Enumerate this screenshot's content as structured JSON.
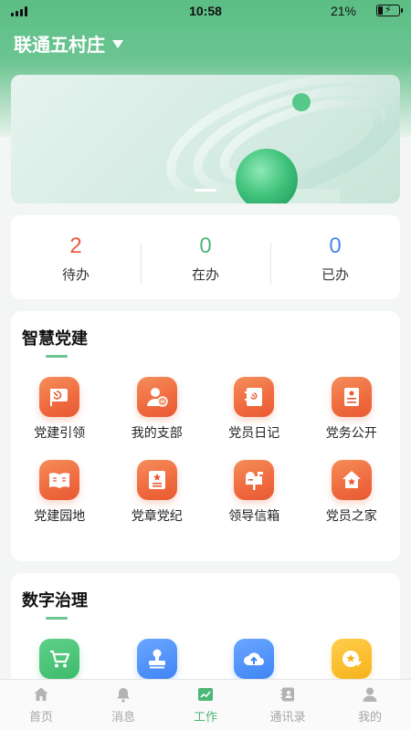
{
  "status_bar": {
    "time": "10:58",
    "battery": "21%",
    "battery_level": 0.21
  },
  "header": {
    "village": "联通五村庄"
  },
  "stats": [
    {
      "num": "2",
      "label": "待办",
      "color": "#e85a3c"
    },
    {
      "num": "0",
      "label": "在办",
      "color": "#4cb878"
    },
    {
      "num": "0",
      "label": "已办",
      "color": "#4a86e8"
    }
  ],
  "party_section": {
    "title": "智慧党建",
    "items": [
      {
        "label": "党建引领",
        "icon": "party-flag-icon"
      },
      {
        "label": "我的支部",
        "icon": "branch-member-icon"
      },
      {
        "label": "党员日记",
        "icon": "diary-book-icon"
      },
      {
        "label": "党务公开",
        "icon": "notice-document-icon"
      },
      {
        "label": "党建园地",
        "icon": "open-book-icon"
      },
      {
        "label": "党章党纪",
        "icon": "rules-book-icon"
      },
      {
        "label": "领导信箱",
        "icon": "mailbox-icon"
      },
      {
        "label": "党员之家",
        "icon": "home-star-icon"
      }
    ]
  },
  "digital_section": {
    "title": "数字治理",
    "items": [
      {
        "icon": "shopping-cart-icon",
        "color": "green"
      },
      {
        "icon": "stamp-icon",
        "color": "blue"
      },
      {
        "icon": "cloud-upload-icon",
        "color": "blue"
      },
      {
        "icon": "star-badge-icon",
        "color": "yellow"
      }
    ]
  },
  "tabbar": [
    {
      "label": "首页",
      "icon": "home-icon",
      "active": false
    },
    {
      "label": "消息",
      "icon": "bell-icon",
      "active": false
    },
    {
      "label": "工作",
      "icon": "work-chart-icon",
      "active": true
    },
    {
      "label": "通讯录",
      "icon": "contacts-icon",
      "active": false
    },
    {
      "label": "我的",
      "icon": "profile-icon",
      "active": false
    }
  ],
  "colors": {
    "accent": "#4cb878",
    "header_green": "#5bbe84",
    "icon_orange": "#ef6a3f"
  }
}
